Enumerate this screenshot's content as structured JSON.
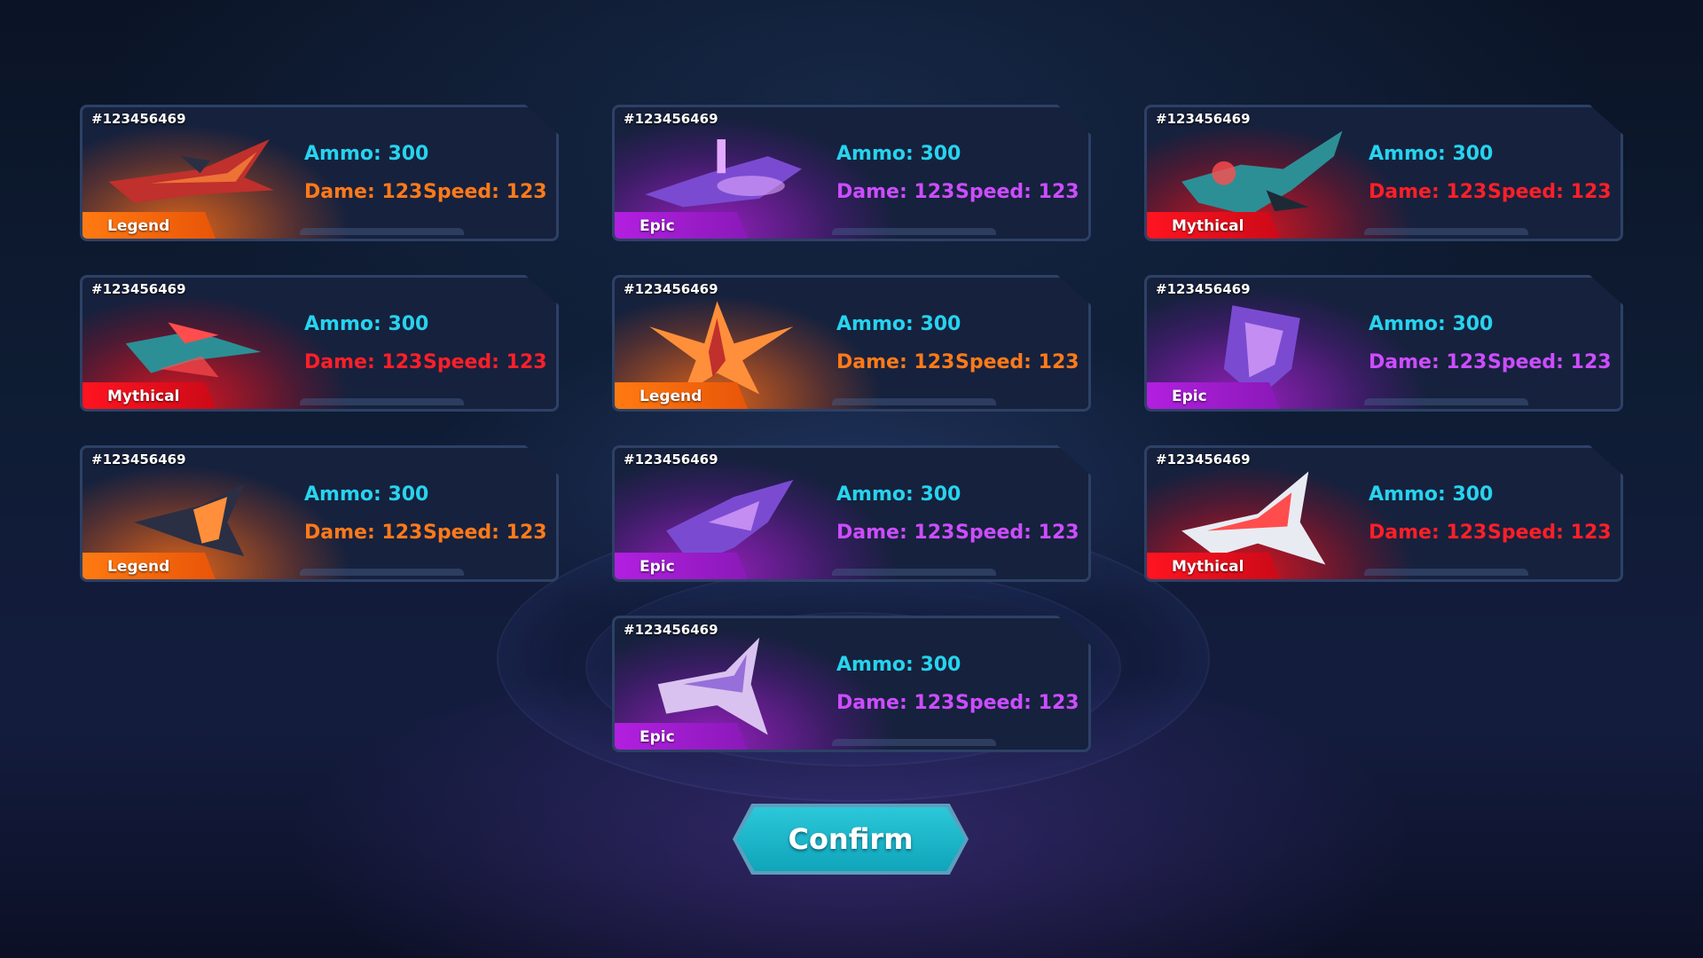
{
  "colors": {
    "ammo": "#27d3ee",
    "legend": "#ff7a1a",
    "epic": "#cc4dff",
    "mythical": "#ff1f28",
    "confirm": "#1bb6c9"
  },
  "cards": [
    {
      "id": "#123456469",
      "rarity": "Legend",
      "ammo": "Ammo: 300",
      "dame": "Dame: 123",
      "speed": "Speed: 123",
      "ship_icon": "red-jet-fighter-icon"
    },
    {
      "id": "#123456469",
      "rarity": "Epic",
      "ammo": "Ammo: 300",
      "dame": "Dame: 123",
      "speed": "Speed: 123",
      "ship_icon": "purple-cruiser-ship-icon"
    },
    {
      "id": "#123456469",
      "rarity": "Mythical",
      "ammo": "Ammo: 300",
      "dame": "Dame: 123",
      "speed": "Speed: 123",
      "ship_icon": "teal-gunship-icon"
    },
    {
      "id": "#123456469",
      "rarity": "Mythical",
      "ammo": "Ammo: 300",
      "dame": "Dame: 123",
      "speed": "Speed: 123",
      "ship_icon": "blue-claw-ship-icon"
    },
    {
      "id": "#123456469",
      "rarity": "Legend",
      "ammo": "Ammo: 300",
      "dame": "Dame: 123",
      "speed": "Speed: 123",
      "ship_icon": "gold-fighter-icon"
    },
    {
      "id": "#123456469",
      "rarity": "Epic",
      "ammo": "Ammo: 300",
      "dame": "Dame: 123",
      "speed": "Speed: 123",
      "ship_icon": "cyan-mech-ship-icon"
    },
    {
      "id": "#123456469",
      "rarity": "Legend",
      "ammo": "Ammo: 300",
      "dame": "Dame: 123",
      "speed": "Speed: 123",
      "ship_icon": "yellow-interceptor-icon"
    },
    {
      "id": "#123456469",
      "rarity": "Epic",
      "ammo": "Ammo: 300",
      "dame": "Dame: 123",
      "speed": "Speed: 123",
      "ship_icon": "violet-bomber-icon"
    },
    {
      "id": "#123456469",
      "rarity": "Mythical",
      "ammo": "Ammo: 300",
      "dame": "Dame: 123",
      "speed": "Speed: 123",
      "ship_icon": "red-white-fighter-icon"
    },
    {
      "id": "#123456469",
      "rarity": "Epic",
      "ammo": "Ammo: 300",
      "dame": "Dame: 123",
      "speed": "Speed: 123",
      "ship_icon": "pink-jet-icon"
    }
  ],
  "confirm_label": "Confirm"
}
